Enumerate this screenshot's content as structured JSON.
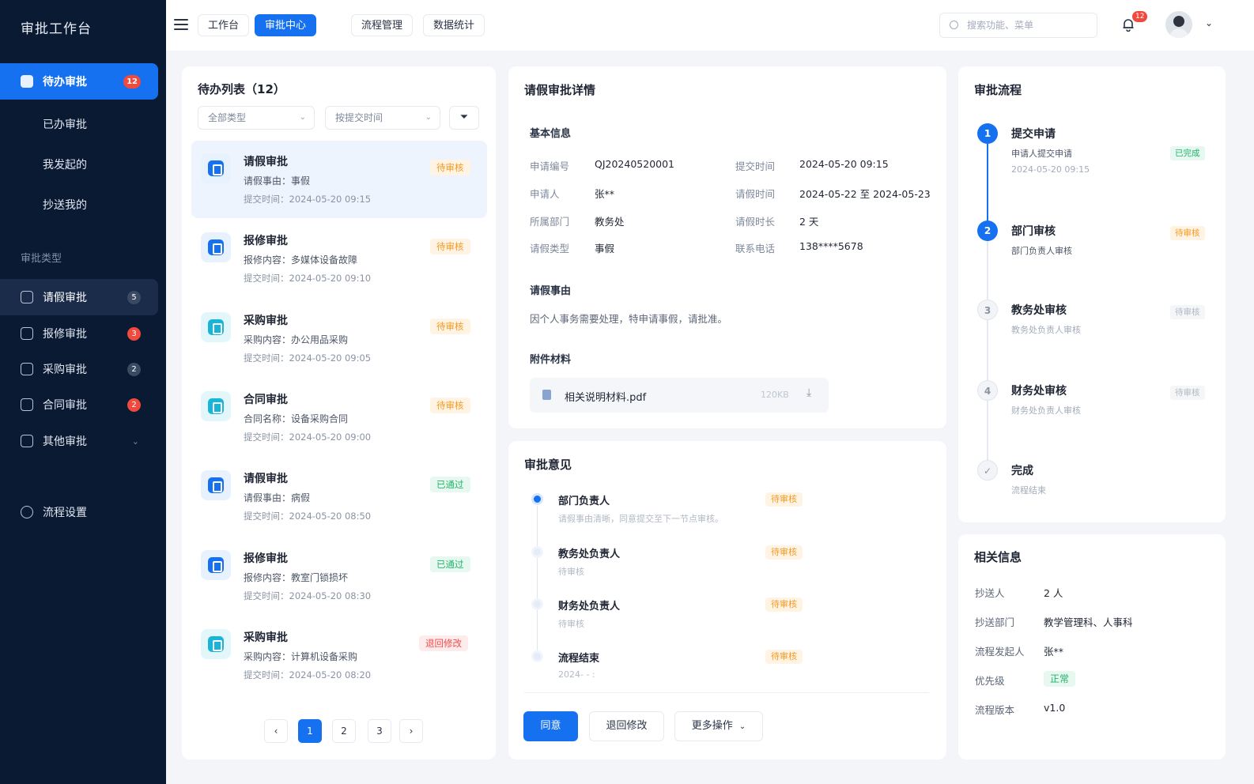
{
  "sidebar": {
    "title": "审批工作台",
    "items": [
      {
        "label": "待办审批",
        "badge": "12"
      },
      {
        "label": "已办审批"
      },
      {
        "label": "我发起的"
      },
      {
        "label": "抄送我的"
      }
    ],
    "section_label": "审批类型",
    "types": [
      {
        "label": "请假审批",
        "badge": "5"
      },
      {
        "label": "报修审批",
        "badge": "3"
      },
      {
        "label": "采购审批",
        "badge": "2"
      },
      {
        "label": "合同审批",
        "badge": "2"
      },
      {
        "label": "其他审批"
      }
    ],
    "settings_label": "流程设置"
  },
  "topbar": {
    "tabs": [
      "工作台",
      "审批中心",
      "流程管理",
      "数据统计"
    ],
    "active_tab": "审批中心",
    "search_placeholder": "搜索功能、菜单",
    "notification_count": "12"
  },
  "todo": {
    "title": "待办列表（12）",
    "filter_type": "全部类型",
    "filter_sort": "按提交时间",
    "items": [
      {
        "title": "请假审批",
        "desc": "请假事由：事假",
        "time": "提交时间：2024-05-20 09:15",
        "status": "待审核",
        "kind": "warn"
      },
      {
        "title": "报修审批",
        "desc": "报修内容：多媒体设备故障",
        "time": "提交时间：2024-05-20 09:10",
        "status": "待审核",
        "kind": "warn"
      },
      {
        "title": "采购审批",
        "desc": "采购内容：办公用品采购",
        "time": "提交时间：2024-05-20 09:05",
        "status": "待审核",
        "kind": "warn"
      },
      {
        "title": "合同审批",
        "desc": "合同名称：设备采购合同",
        "time": "提交时间：2024-05-20 09:00",
        "status": "待审核",
        "kind": "warn"
      },
      {
        "title": "请假审批",
        "desc": "请假事由：病假",
        "time": "提交时间：2024-05-20 08:50",
        "status": "已通过",
        "kind": "ok"
      },
      {
        "title": "报修审批",
        "desc": "报修内容：教室门锁损坏",
        "time": "提交时间：2024-05-20 08:30",
        "status": "已通过",
        "kind": "ok"
      },
      {
        "title": "采购审批",
        "desc": "采购内容：计算机设备采购",
        "time": "提交时间：2024-05-20 08:20",
        "status": "退回修改",
        "kind": "bad"
      }
    ],
    "pagination": {
      "prev": "‹",
      "pages": [
        "1",
        "2",
        "3"
      ],
      "next": "›",
      "current": "1"
    }
  },
  "detail": {
    "title": "请假审批详情",
    "basic_title": "基本信息",
    "fields": {
      "app_no_label": "申请编号",
      "app_no": "QJ20240520001",
      "submit_label": "提交时间",
      "submit": "2024-05-20 09:15",
      "applicant_label": "申请人",
      "applicant": "张**",
      "leave_time_label": "请假时间",
      "leave_time": "2024-05-22 至 2024-05-23",
      "dept_label": "所属部门",
      "dept": "教务处",
      "duration_label": "请假时长",
      "duration": "2 天",
      "type_label": "请假类型",
      "type": "事假",
      "phone_label": "联系电话",
      "phone": "138****5678"
    },
    "reason_title": "请假事由",
    "reason": "因个人事务需要处理，特申请事假，请批准。",
    "attach_title": "附件材料",
    "attachment": {
      "name": "相关说明材料.pdf",
      "size": "120KB"
    }
  },
  "opinions": {
    "title": "审批意见",
    "items": [
      {
        "name": "部门负责人",
        "note": "请假事由清晰，同意提交至下一节点审核。",
        "status": "待审核"
      },
      {
        "name": "教务处负责人",
        "note": "待审核",
        "status": "待审核"
      },
      {
        "name": "财务处负责人",
        "note": "待审核",
        "status": "待审核"
      },
      {
        "name": "流程结束",
        "note": "2024-  -  :  ",
        "status": "待审核"
      }
    ],
    "actions": {
      "approve": "同意",
      "return": "退回修改",
      "more": "更多操作"
    }
  },
  "flow": {
    "title": "审批流程",
    "steps": [
      {
        "num": "1",
        "name": "提交申请",
        "sub": "申请人提交申请",
        "time": "2024-05-20 09:15",
        "status": "已完成"
      },
      {
        "num": "2",
        "name": "部门审核",
        "sub": "部门负责人审核",
        "status": "待审核"
      },
      {
        "num": "3",
        "name": "教务处审核",
        "sub": "教务处负责人审核",
        "status": "待审核"
      },
      {
        "num": "4",
        "name": "财务处审核",
        "sub": "财务处负责人审核",
        "status": "待审核"
      },
      {
        "num": "✓",
        "name": "完成",
        "sub": "流程结束"
      }
    ]
  },
  "related": {
    "title": "相关信息",
    "rows": [
      {
        "label": "抄送人",
        "value": "2 人"
      },
      {
        "label": "抄送部门",
        "value": "教学管理科、人事科"
      },
      {
        "label": "流程发起人",
        "value": "张**"
      },
      {
        "label": "优先级",
        "value": "正常"
      },
      {
        "label": "流程版本",
        "value": "v1.0"
      }
    ]
  },
  "colors": {
    "primary": "#1671f0",
    "sidebar": "#0b1a33",
    "warn": "#f59a23",
    "ok": "#25b36b",
    "bad": "#ef4a4a"
  }
}
